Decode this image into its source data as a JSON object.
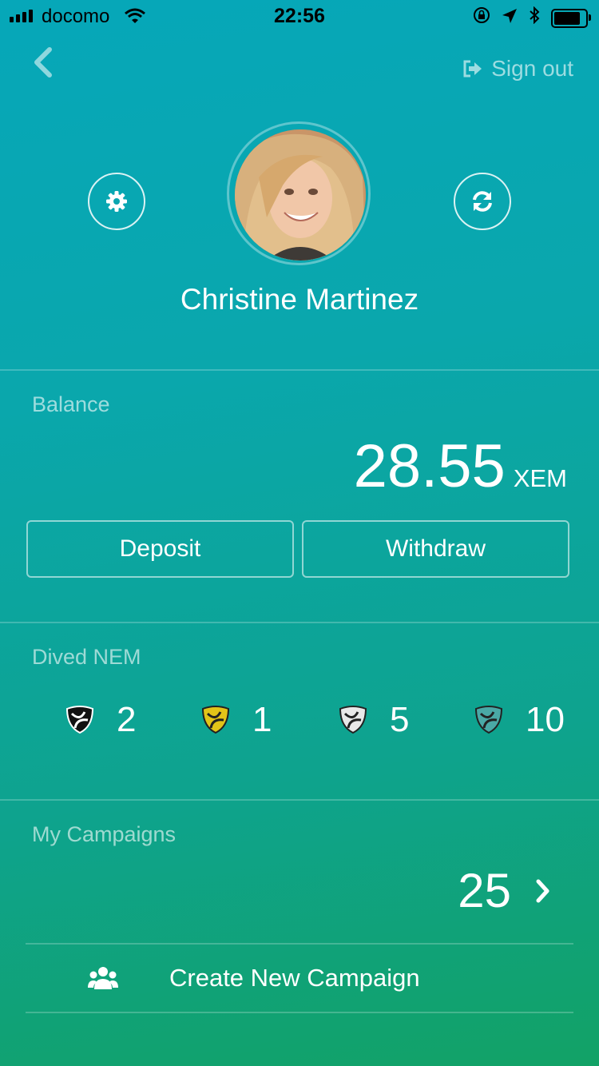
{
  "status_bar": {
    "carrier": "docomo",
    "time": "22:56"
  },
  "header": {
    "sign_out_label": "Sign out"
  },
  "profile": {
    "name": "Christine Martinez"
  },
  "balance": {
    "label": "Balance",
    "value": "28.55",
    "unit": "XEM",
    "deposit_label": "Deposit",
    "withdraw_label": "Withdraw"
  },
  "dived_nem": {
    "label": "Dived NEM",
    "items": [
      {
        "icon": "nem-black-icon",
        "color": "#111111",
        "count": "2"
      },
      {
        "icon": "nem-yellow-icon",
        "color": "#e2c418",
        "count": "1"
      },
      {
        "icon": "nem-white-icon",
        "color": "#e8e8e8",
        "count": "5"
      },
      {
        "icon": "nem-teal-icon",
        "color": "#4aa9a6",
        "count": "10"
      }
    ]
  },
  "campaigns": {
    "label": "My Campaigns",
    "count": "25",
    "create_label": "Create New Campaign"
  }
}
